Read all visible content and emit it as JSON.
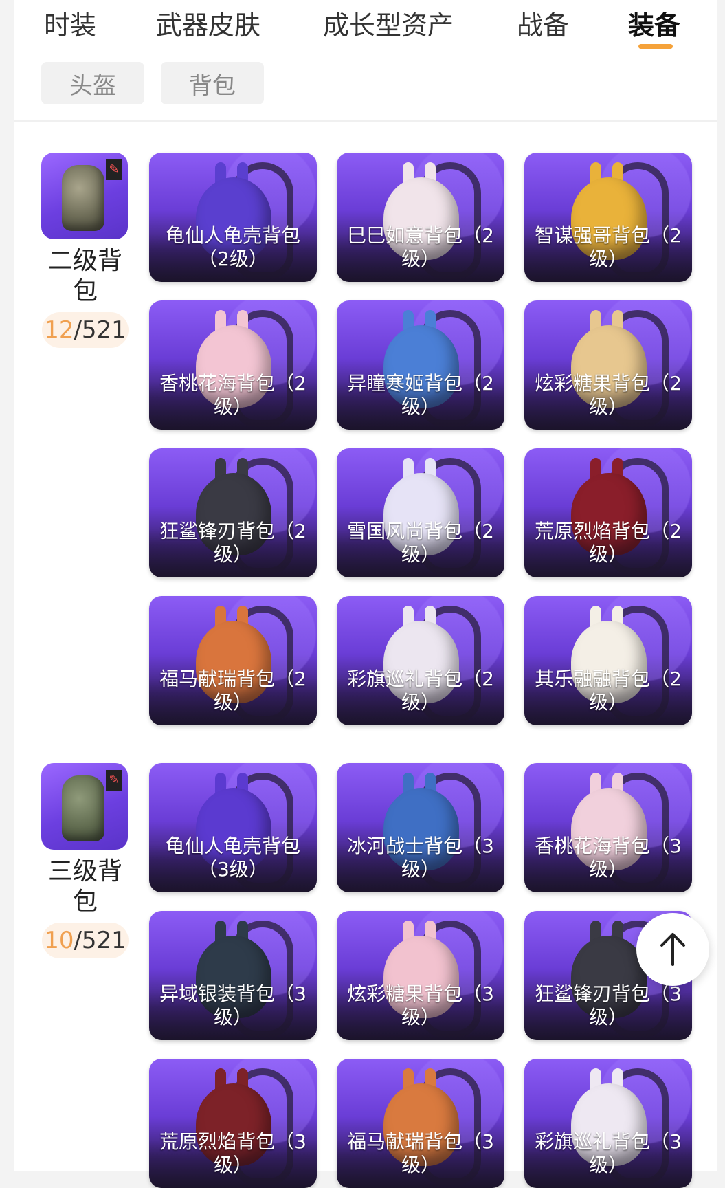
{
  "tabs": [
    {
      "label": "时装",
      "active": false
    },
    {
      "label": "武器皮肤",
      "active": false
    },
    {
      "label": "成长型资产",
      "active": false
    },
    {
      "label": "战备",
      "active": false
    },
    {
      "label": "装备",
      "active": true
    }
  ],
  "accent_color": "#f5a23a",
  "filters": [
    {
      "label": "头盔"
    },
    {
      "label": "背包"
    }
  ],
  "categories": [
    {
      "name": "二级背包",
      "owned": "12",
      "total": "/521",
      "items": [
        {
          "label": "龟仙人龟壳背包（2级）",
          "color": "#5a3fcf"
        },
        {
          "label": "巳巳如意背包（2级）",
          "color": "#f1e4ea"
        },
        {
          "label": "智谋强哥背包（2级）",
          "color": "#e9b23a"
        },
        {
          "label": "香桃花海背包（2级）",
          "color": "#f3c5d3"
        },
        {
          "label": "异瞳寒姬背包（2级）",
          "color": "#4b7fd6"
        },
        {
          "label": "炫彩糖果背包（2级）",
          "color": "#e7c78f"
        },
        {
          "label": "狂鲨锋刃背包（2级）",
          "color": "#3a3a44"
        },
        {
          "label": "雪国风尚背包（2级）",
          "color": "#e6e3f6"
        },
        {
          "label": "荒原烈焰背包（2级）",
          "color": "#8a1e2a"
        },
        {
          "label": "福马献瑞背包（2级）",
          "color": "#d9753d"
        },
        {
          "label": "彩旗巡礼背包（2级）",
          "color": "#ece6f0"
        },
        {
          "label": "其乐融融背包（2级）",
          "color": "#f4efe6"
        }
      ]
    },
    {
      "name": "三级背包",
      "owned": "10",
      "total": "/521",
      "items": [
        {
          "label": "龟仙人龟壳背包（3级）",
          "color": "#5b3ad0"
        },
        {
          "label": "冰河战士背包（3级）",
          "color": "#3f6fc4"
        },
        {
          "label": "香桃花海背包（3级）",
          "color": "#f1d0dc"
        },
        {
          "label": "异域银装背包（3级）",
          "color": "#2e3b4a"
        },
        {
          "label": "炫彩糖果背包（3级）",
          "color": "#f2c2cf"
        },
        {
          "label": "狂鲨锋刃背包（3级）",
          "color": "#3a3a44"
        },
        {
          "label": "荒原烈焰背包（3级）",
          "color": "#7d2228"
        },
        {
          "label": "福马献瑞背包（3级）",
          "color": "#d97a3f"
        },
        {
          "label": "彩旗巡礼背包（3级）",
          "color": "#eee8f2"
        }
      ]
    }
  ],
  "icons": {
    "back_to_top": "arrow-up-icon"
  }
}
